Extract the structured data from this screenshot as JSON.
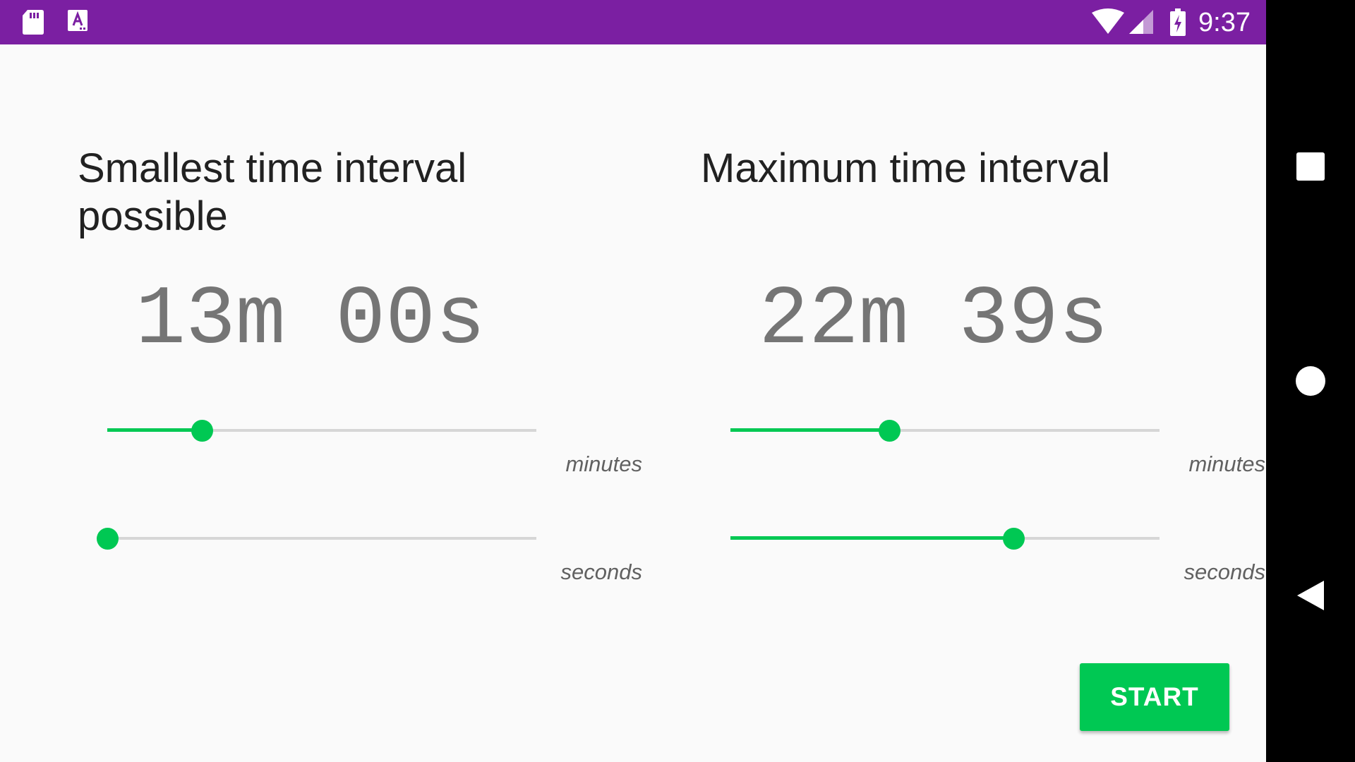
{
  "status_bar": {
    "time": "9:37",
    "left_icons": [
      "sd-card-icon",
      "app-notification-icon"
    ],
    "right_icons": [
      "wifi-icon",
      "cell-signal-icon",
      "battery-charging-icon"
    ],
    "background_color": "#7b1fa2"
  },
  "panels": [
    {
      "title": "Smallest time interval possible",
      "display": "13m 00s",
      "sliders": [
        {
          "label": "minutes",
          "value": 0.22
        },
        {
          "label": "seconds",
          "value": 0.0
        }
      ]
    },
    {
      "title": "Maximum time interval",
      "display": "22m 39s",
      "sliders": [
        {
          "label": "minutes",
          "value": 0.37
        },
        {
          "label": "seconds",
          "value": 0.66
        }
      ]
    }
  ],
  "start_button": {
    "label": "START"
  },
  "nav_bar": {
    "icons": [
      "recents-icon",
      "home-icon",
      "back-icon"
    ]
  },
  "colors": {
    "accent": "#00c853",
    "track": "#d6d6d6",
    "title_text": "#212121",
    "display_text": "#757575",
    "label_text": "#616161"
  }
}
